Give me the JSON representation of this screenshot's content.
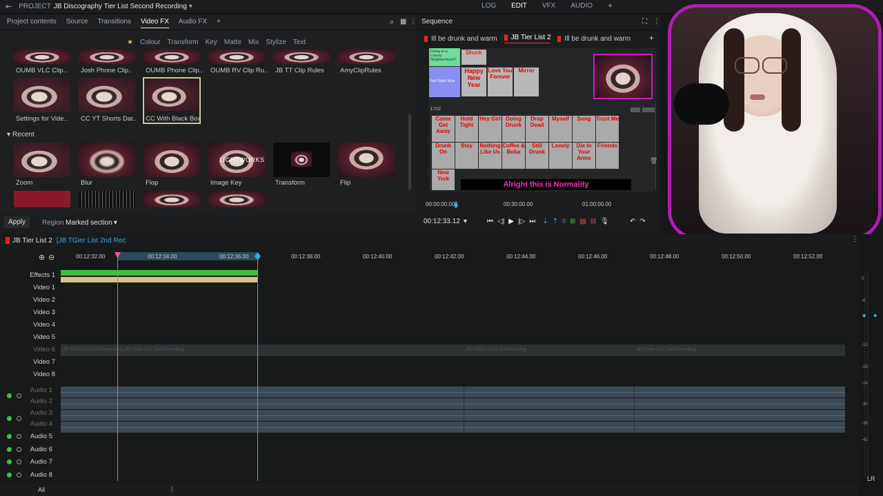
{
  "topbar": {
    "project_label": "PROJECT",
    "project_name": "JB Discography Tier List Second Recording",
    "modes": [
      "LOG",
      "EDIT",
      "VFX",
      "AUDIO"
    ],
    "active_mode": "EDIT"
  },
  "left": {
    "tabs": [
      "Project contents",
      "Source",
      "Transitions",
      "Video FX",
      "Audio FX"
    ],
    "active_tab": "Video FX",
    "subtabs": [
      "Colour",
      "Transform",
      "Key",
      "Matte",
      "Mix",
      "Stylize",
      "Text"
    ],
    "favourites_row1": [
      "OUMB VLC Clip..",
      "Josh Phone Clip..",
      "OUMB Phone Clip..",
      "OUMB RV Clip Ru..",
      "JB TT Clip Rules",
      "AmyClipRules"
    ],
    "favourites_row2": [
      "Settings for Vide..",
      "CC YT Shorts Dar..",
      "CC With Black Box.."
    ],
    "recent_label": "Recent",
    "recent": [
      "Zoom",
      "Blur",
      "Flop",
      "Image Key",
      "Transform",
      "Flip"
    ],
    "lightworks_label": "LIGHTWORKS",
    "apply_label": "Apply",
    "region_label": "Region",
    "region_value": "Marked section"
  },
  "sequence": {
    "title": "Sequence",
    "tabs": [
      "Ill be drunk and warm",
      "JB Tier List 2",
      "Ill be drunk and warm"
    ],
    "active_tab": "JB Tier List 2",
    "viewer_caption": "Alright this is Normality",
    "tier_top": "Doing in a Luxury Neighborhood?",
    "tier_bottom": "Not Right Now",
    "tier_count": "17/22",
    "scrub_times": [
      "00:00:00.00",
      "00:30:00.00",
      "01:00:00.00"
    ],
    "current_time": "00:12:33.12",
    "tier_words_row1": [
      "Drunk",
      "Happy New Year",
      "Love You Forever",
      "Mirror"
    ],
    "tier_words_row2": [
      "Come Get Away",
      "Hold Tight",
      "Hey Girl",
      "Doing Drunk",
      "Drop Dead",
      "Myself",
      "Song",
      "Trust Me"
    ],
    "tier_words_row3": [
      "Drunk On",
      "Stay",
      "Nothing Like Us",
      "Coffee & Boba",
      "Still Drunk",
      "Lonely",
      "Die In Your Arms",
      "Friends",
      "New York"
    ]
  },
  "timeline": {
    "sequence_name": "JB Tier List 2",
    "source_name": "[JB TGier List 2nd Rec",
    "ticks": [
      "00:12:32.00",
      "00:12:34.00",
      "00:12:36.00",
      "00:12:38.00",
      "00:12:40.00",
      "00:12:42.00",
      "00:12:44.00",
      "00:12:46.00",
      "00:12:48.00",
      "00:12:50.00",
      "00:12:52.00"
    ],
    "video_tracks": [
      "Effects 1",
      "Video 1",
      "Video 2",
      "Video 3",
      "Video 4",
      "Video 5",
      "Video 6",
      "Video 7",
      "Video 8"
    ],
    "audio_tracks": [
      "Audio 1",
      "Audio 2",
      "Audio 3",
      "Audio 4",
      "Audio 5",
      "Audio 6",
      "Audio 7",
      "Audio 8"
    ],
    "clip_text": "JB TGier List 2nd Recording",
    "all_label": "All",
    "meter_scale": [
      "0",
      "-6",
      "-12",
      "-18",
      "-24",
      "-30",
      "-36",
      "-42"
    ],
    "lr_label": "LR"
  },
  "colors": {
    "accent": "#e8b84a",
    "clip_green": "#3fbf3f",
    "clip_tan": "#d9c08a",
    "playhead": "#ff4fa0",
    "cursor": "#3aa7e0",
    "cam_border": "#b21ab8"
  }
}
